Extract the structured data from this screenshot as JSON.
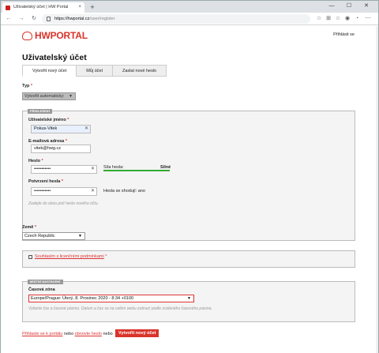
{
  "browser": {
    "tab_title": "Uživatelský účet | HW Portal",
    "tab_close": "×",
    "new_tab": "+",
    "min": "—",
    "max": "☐",
    "close": "✕",
    "url_host": "https://hwportal.cz",
    "url_path": "/user/register"
  },
  "header": {
    "logo_hw": "HW",
    "logo_portal": "PORTAL",
    "login": "Přihlásit se"
  },
  "page": {
    "title": "Uživatelský účet",
    "tabs": [
      "Vytvořit nový účet",
      "Můj účet",
      "Zaslat nové heslo"
    ]
  },
  "type": {
    "label": "Typ",
    "value": "Vytvořit automaticky:"
  },
  "account": {
    "legend": "PŘIHLÁŠENÍ",
    "username_label": "Uživatelské jméno",
    "username_value": "Pokus-Vitek",
    "email_label": "E-mailová adresa",
    "email_value": "vitek@hwg.cz",
    "password_label": "Heslo",
    "password_value": "•••••••••••",
    "strength_label": "Síla hesla:",
    "strength_value": "Silné",
    "confirm_label": "Potvrzení hesla",
    "confirm_value": "•••••••••••",
    "match_text": "Hesla se shodují: ano",
    "hint": "Zadejte do obou polí heslo nového účtu."
  },
  "country": {
    "label": "Země",
    "value": "Czech Republic"
  },
  "terms": {
    "link": "Souhlasím s licenčními podmínkami"
  },
  "local": {
    "legend": "MÍSTNÍ NASTAVENÍ",
    "timezone_label": "Časová zóna",
    "timezone_value": "Europe/Prague: Úterý, 8. Prosinec 2020 - 8:34 +0100",
    "hint": "Vyberte čas a časové pásmo. Datum a čas se na celém webu zobrazí podle zvoleného časového pásma."
  },
  "footer": {
    "login_link": "Přihlaste se k portálu",
    "or1": "nebo",
    "forgot_link": "obnovte heslo",
    "or2": "nebo",
    "create_button": "Vytvořit nový účet"
  },
  "colors": {
    "brand": "#d9342b",
    "strength": "#33aa33"
  }
}
